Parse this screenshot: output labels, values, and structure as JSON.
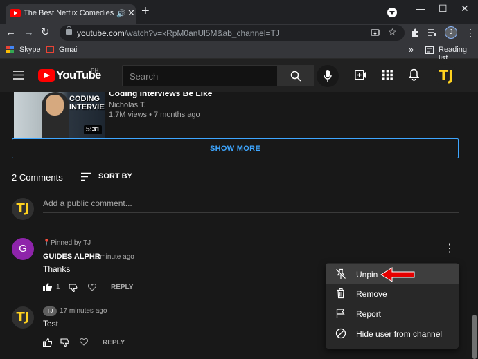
{
  "browser": {
    "tab_title": "The Best Netflix Comedies of",
    "url_host": "youtube.com",
    "url_path": "/watch?v=kRpM0anUl5M&ab_channel=TJ",
    "profile_initial": "J",
    "bookmarks": [
      {
        "label": "Skype"
      },
      {
        "label": "Gmail"
      }
    ],
    "reading_list": "Reading list"
  },
  "youtube": {
    "logo_text": "YouTube",
    "region": "PH",
    "search_placeholder": "Search",
    "account_initials": "TJ"
  },
  "video": {
    "title": "Coding Interviews Be Like",
    "channel": "Nicholas T.",
    "meta": "1.7M views • 7 months ago",
    "duration": "5:31",
    "thumb_text": "CODING INTERVIEW"
  },
  "show_more": "SHOW MORE",
  "comments_header": {
    "count": "2 Comments",
    "sort": "SORT BY"
  },
  "add_comment": {
    "avatar": "TJ",
    "placeholder": "Add a public comment..."
  },
  "comments": [
    {
      "avatar": "G",
      "avatar_color": "#8e24aa",
      "pinned": "Pinned by TJ",
      "author": "GUIDES ALPHR",
      "time": "1 minute ago",
      "text": "Thanks",
      "likes": "1",
      "reply": "REPLY"
    },
    {
      "avatar": "TJ",
      "author_badge": "TJ",
      "time": "17 minutes ago",
      "text": "Test",
      "reply": "REPLY"
    }
  ],
  "menu": {
    "items": [
      {
        "label": "Unpin",
        "icon": "unpin-icon"
      },
      {
        "label": "Remove",
        "icon": "trash-icon"
      },
      {
        "label": "Report",
        "icon": "flag-icon"
      },
      {
        "label": "Hide user from channel",
        "icon": "block-icon"
      }
    ]
  },
  "colors": {
    "accent_blue": "#3ea6ff",
    "youtube_red": "#ff0000",
    "annotation_arrow": "#e60000"
  }
}
